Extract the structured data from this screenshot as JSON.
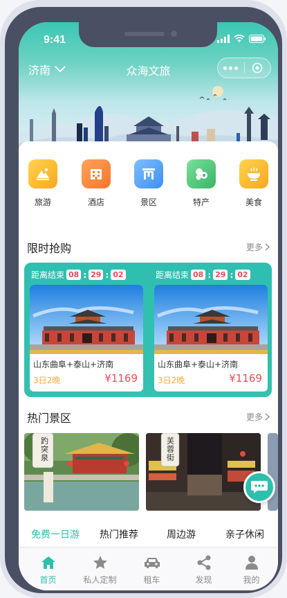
{
  "status_bar": {
    "time": "9:41"
  },
  "header": {
    "city": "济南",
    "title": "众海文旅"
  },
  "categories": [
    {
      "label": "旅游",
      "icon": "mountain-icon",
      "color": "#f7b52b"
    },
    {
      "label": "酒店",
      "icon": "building-icon",
      "color": "#f98a3d"
    },
    {
      "label": "景区",
      "icon": "gate-icon",
      "color": "#4da3f5"
    },
    {
      "label": "特产",
      "icon": "fruit-icon",
      "color": "#4dc67d"
    },
    {
      "label": "美食",
      "icon": "bowl-icon",
      "color": "#f7b52b"
    }
  ],
  "flash_sale": {
    "title": "限时抢购",
    "more": "更多",
    "items": [
      {
        "countdown_label": "距离结束",
        "h": "08",
        "m": "29",
        "s": "02",
        "name": "山东曲阜+泰山+济南",
        "nights": "3日2晚",
        "price": "¥1169"
      },
      {
        "countdown_label": "距离结束",
        "h": "08",
        "m": "29",
        "s": "02",
        "name": "山东曲阜+泰山+济南",
        "nights": "3日2晚",
        "price": "¥1169"
      }
    ]
  },
  "hot_scenic": {
    "title": "热门景区",
    "more": "更多",
    "items": [
      {
        "sign": "趵突泉"
      },
      {
        "sign": "芙蓉街"
      }
    ]
  },
  "tabs": [
    {
      "label": "免费一日游",
      "active": true
    },
    {
      "label": "热门推荐",
      "active": false
    },
    {
      "label": "周边游",
      "active": false
    },
    {
      "label": "亲子休闲",
      "active": false
    }
  ],
  "tabbar": [
    {
      "label": "首页",
      "icon": "home-icon",
      "active": true
    },
    {
      "label": "私人定制",
      "icon": "star-icon",
      "active": false
    },
    {
      "label": "租车",
      "icon": "car-icon",
      "active": false
    },
    {
      "label": "发现",
      "icon": "share-icon",
      "active": false
    },
    {
      "label": "我的",
      "icon": "user-icon",
      "active": false
    }
  ],
  "colors": {
    "brand": "#2ebfae",
    "price": "#f04a5b",
    "nights": "#f7ad3f"
  }
}
